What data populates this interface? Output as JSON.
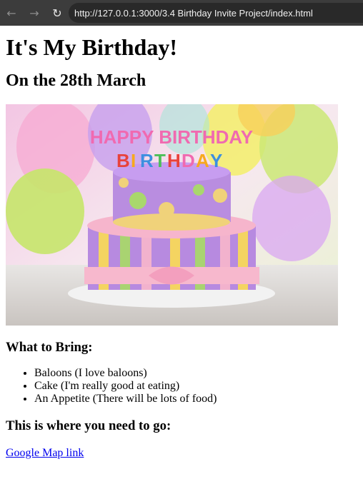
{
  "browser": {
    "url": "http://127.0.0.1:3000/3.4 Birthday Invite Project/index.html"
  },
  "page": {
    "title": "It's My Birthday!",
    "date_heading": "On the 28th March",
    "image_cake_text": "HAPPY BIRTHDAY",
    "bring_heading": "What to Bring:",
    "bring_items": [
      "Baloons (I love baloons)",
      "Cake (I'm really good at eating)",
      "An Appetite (There will be lots of food)"
    ],
    "directions_heading": "This is where you need to go:",
    "map_link": "Google Map link"
  }
}
